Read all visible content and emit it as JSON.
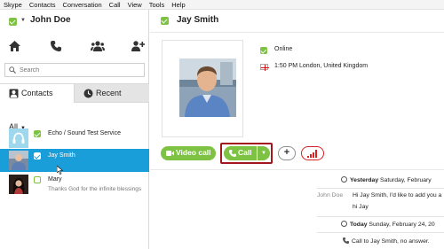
{
  "menu": [
    "Skype",
    "Contacts",
    "Conversation",
    "Call",
    "View",
    "Tools",
    "Help"
  ],
  "user": {
    "name": "John Doe"
  },
  "search": {
    "placeholder": "Search"
  },
  "tabs": {
    "contacts": "Contacts",
    "recent": "Recent"
  },
  "filter": {
    "label": "All"
  },
  "contacts": [
    {
      "name": "Echo / Sound Test Service",
      "mood": "",
      "icon": "headset-avatar"
    },
    {
      "name": "Jay  Smith",
      "mood": "",
      "icon": "photo-avatar",
      "selected": true
    },
    {
      "name": "Mary",
      "mood": "Thanks God for the infinite blessings",
      "icon": "photo-avatar"
    }
  ],
  "conversation": {
    "name": "Jay  Smith",
    "presence": "Online",
    "local_time": "1:50 PM London, United Kingdom",
    "video_call": "Video call",
    "call": "Call",
    "add": "+"
  },
  "history": {
    "day1_label": "Yesterday",
    "day1_date": "Saturday, February",
    "sender": "John Doe",
    "msg1": "Hi Jay  Smith, I'd like to add you a",
    "msg2": "hi Jay",
    "day2_label": "Today",
    "day2_date": "Sunday, February 24, 20",
    "event": "Call to Jay  Smith, no answer."
  },
  "colors": {
    "accent_green": "#7dc242",
    "selection_blue": "#1a9ed9",
    "highlight_red": "#a4161e"
  }
}
